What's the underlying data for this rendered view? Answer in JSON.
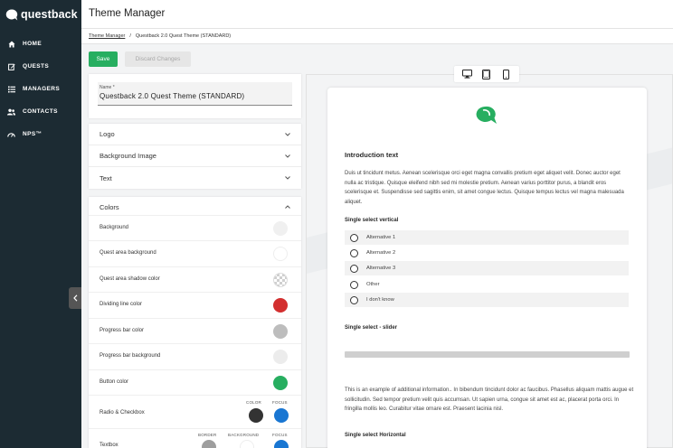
{
  "brand": {
    "name": "questback",
    "accent": "#27ae60"
  },
  "sidebar": {
    "items": [
      {
        "label": "HOME",
        "icon": "home-icon"
      },
      {
        "label": "QUESTS",
        "icon": "edit-icon"
      },
      {
        "label": "MANAGERS",
        "icon": "list-icon"
      },
      {
        "label": "CONTACTS",
        "icon": "contacts-icon"
      },
      {
        "label": "NPS™",
        "icon": "gauge-icon"
      }
    ]
  },
  "header": {
    "title": "Theme Manager"
  },
  "breadcrumb": {
    "root": "Theme Manager",
    "separator": "/",
    "current": "Questback 2.0 Quest Theme (STANDARD)"
  },
  "toolbar": {
    "save_label": "Save",
    "discard_label": "Discard Changes"
  },
  "theme_form": {
    "name_label": "Name *",
    "name_value": "Questback 2.0 Quest Theme (STANDARD)",
    "sections": [
      "Logo",
      "Background Image",
      "Text"
    ],
    "colors": {
      "title": "Colors",
      "rows": [
        {
          "label": "Background",
          "color": "#f0f0f0"
        },
        {
          "label": "Quest area background",
          "color": "#ffffff"
        },
        {
          "label": "Quest area shadow color",
          "color": "checkered"
        },
        {
          "label": "Dividing line color",
          "color": "#d32f2f"
        },
        {
          "label": "Progress bar color",
          "color": "#bdbdbd"
        },
        {
          "label": "Progress bar background",
          "color": "#ececec"
        },
        {
          "label": "Button color",
          "color": "#27ae60"
        }
      ],
      "radio_checkbox": {
        "label": "Radio & Checkbox",
        "color_label": "COLOR",
        "focus_label": "FOCUS",
        "color": "#333333",
        "focus": "#1976d2"
      },
      "textbox": {
        "label": "Textbox",
        "border_label": "BORDER",
        "background_label": "BACKGROUND",
        "focus_label": "FOCUS",
        "border": "#9e9e9e",
        "background": "#ffffff",
        "focus": "#1976d2"
      }
    }
  },
  "preview": {
    "devices": [
      "desktop-icon",
      "tablet-icon",
      "mobile-icon"
    ],
    "intro_title": "Introduction text",
    "intro_body": "Duis ut tincidunt metus. Aenean scelerisque orci eget magna convallis pretium eget aliquet velit. Donec auctor eget nulla ac tristique. Quisque eleifend nibh sed mi molestie pretium. Aenean varius porttitor purus, a blandit eros scelerisque et. Suspendisse sed sagittis enim, sit amet congue lectus. Quisque tempus lectus vel magna malesuada aliquet.",
    "q1_title": "Single select vertical",
    "q1_options": [
      "Alternative 1",
      "Alternative 2",
      "Alternative 3",
      "Other",
      "I don't know"
    ],
    "q2_title": "Single select - slider",
    "info_body": "This is an example of additional information.. In bibendum tincidunt dolor ac faucibus. Phasellus aliquam mattis augue et sollicitudin. Sed tempor pretium velit quis accumsan. Ut sapien urna, congue sit amet est ac, placerat porta orci. In fringilla mollis leo. Curabitur vitae ornare est. Praesent lacinia nisl.",
    "q3_title": "Single select Horizontal"
  }
}
